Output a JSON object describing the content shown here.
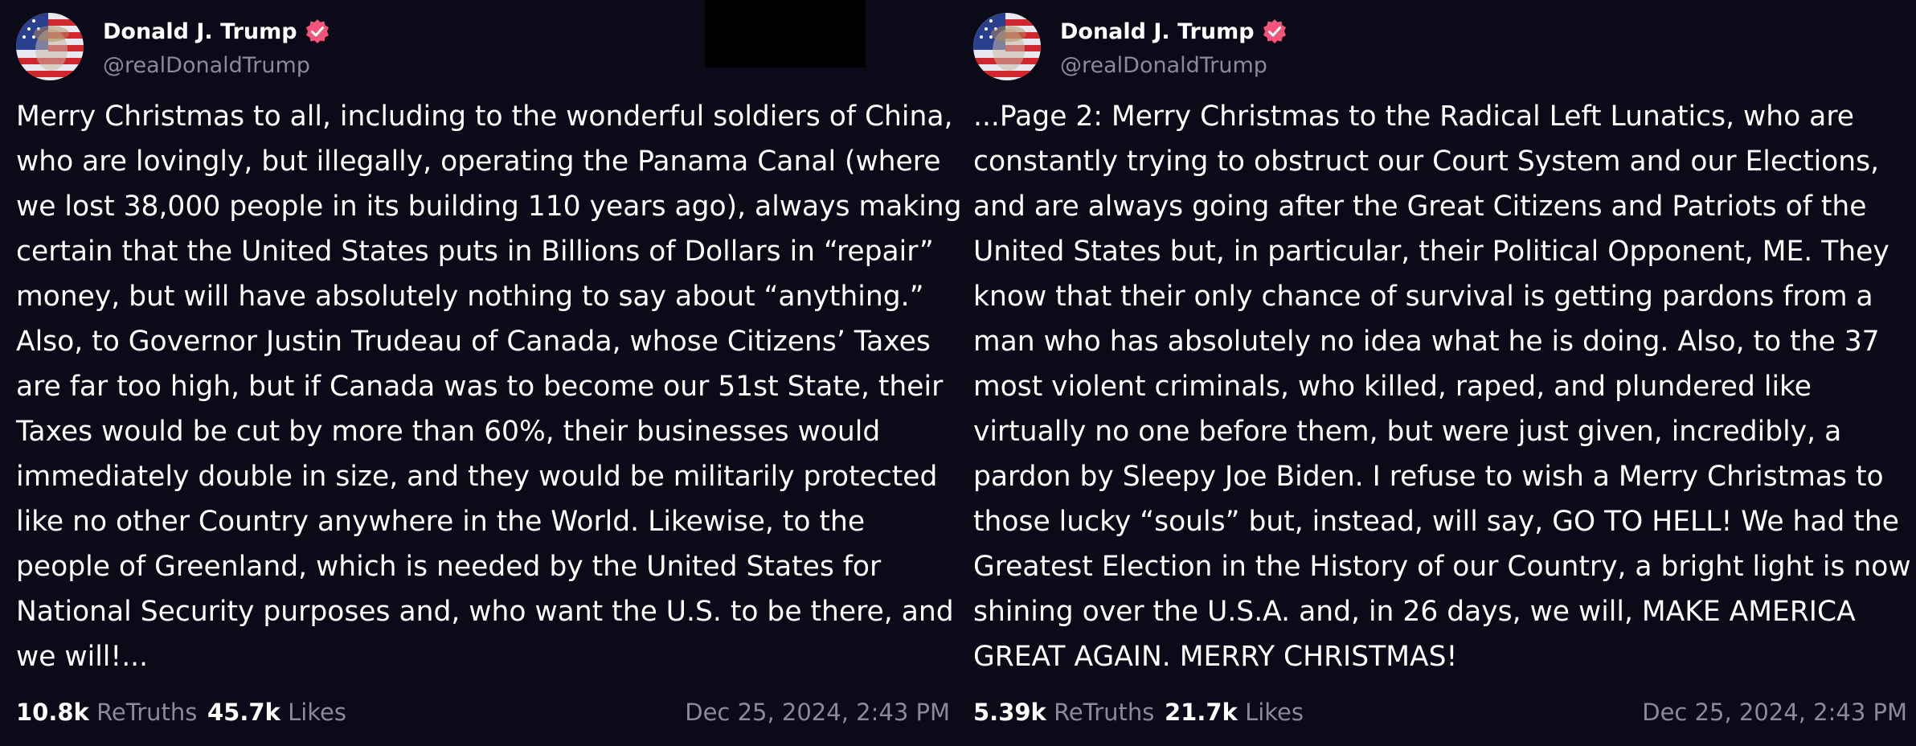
{
  "colors": {
    "background": "#0a0a19",
    "text_primary": "#ffffff",
    "text_secondary": "#8a8a9e",
    "verified_badge": "#f2547a"
  },
  "posts": [
    {
      "author": {
        "name": "Donald J. Trump",
        "handle": "@realDonaldTrump",
        "verified": true,
        "avatar_icon": "avatar-flag-portrait"
      },
      "lines": [
        "Merry Christmas to all, including to the wonderful soldiers of China,",
        "who are lovingly, but illegally, operating the Panama Canal (where",
        "we lost 38,000 people in its building 110 years ago), always making",
        "certain that the United States puts in Billions of Dollars in “repair”",
        "money, but will have absolutely nothing to say about “anything.”",
        "Also, to Governor Justin Trudeau of Canada, whose Citizens’ Taxes",
        "are far too high, but if Canada was to become our 51st State, their",
        "Taxes would be cut by more than 60%, their businesses would",
        "immediately double in size, and they would be militarily protected",
        "like no other Country anywhere in the World. Likewise, to the",
        "people of Greenland, which is needed by the United States for",
        "National Security purposes and, who want the U.S. to be there, and",
        "we will!..."
      ],
      "stats": {
        "retruths_count": "10.8k",
        "retruths_label": "ReTruths",
        "likes_count": "45.7k",
        "likes_label": "Likes"
      },
      "timestamp": "Dec 25, 2024, 2:43 PM"
    },
    {
      "author": {
        "name": "Donald J. Trump",
        "handle": "@realDonaldTrump",
        "verified": true,
        "avatar_icon": "avatar-flag-portrait"
      },
      "lines": [
        "...Page 2: Merry Christmas to the Radical Left Lunatics, who are",
        "constantly trying to obstruct our Court System and our Elections,",
        "and are always going after the Great Citizens and Patriots of the",
        "United States but, in particular, their Political Opponent, ME. They",
        "know that their only chance of survival is getting pardons from a",
        "man who has absolutely no idea what he is doing. Also, to the 37",
        "most violent criminals, who killed, raped, and plundered like",
        "virtually no one before them, but were just given, incredibly, a",
        "pardon by Sleepy Joe Biden. I refuse to wish a Merry Christmas to",
        "those lucky “souls” but, instead, will say, GO TO HELL! We had the",
        "Greatest Election in the History of our Country, a bright light is now",
        "shining over the U.S.A. and, in 26 days, we will, MAKE AMERICA",
        "GREAT AGAIN. MERRY CHRISTMAS!"
      ],
      "stats": {
        "retruths_count": "5.39k",
        "retruths_label": "ReTruths",
        "likes_count": "21.7k",
        "likes_label": "Likes"
      },
      "timestamp": "Dec 25, 2024, 2:43 PM"
    }
  ]
}
